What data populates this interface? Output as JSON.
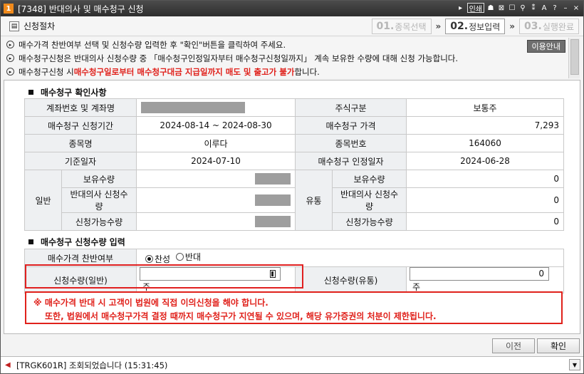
{
  "window": {
    "app_icon": "1",
    "title": "[7348] 반대의사 및 매수청구 신청",
    "tools": [
      "▸",
      "인쇄",
      "☗",
      "⊠",
      "☐",
      "⚲",
      "⁑",
      "A",
      "?",
      "–",
      "×"
    ]
  },
  "stepbar": {
    "label": "신청절차",
    "steps": [
      {
        "num": "01.",
        "label": "종목선택"
      },
      {
        "num": "02.",
        "label": "정보입력"
      },
      {
        "num": "03.",
        "label": "실행완료"
      }
    ],
    "arrow": "»"
  },
  "notice": {
    "line1": "매수가격 찬반여부 선택 및 신청수량 입력한 후 \"확인\"버튼을 클릭하여 주세요.",
    "line2": "매수청구신청은 반대의사 신청수량 중 「매수청구인정일자부터 매수청구신청일까지」 계속 보유한 수량에 대해 신청 가능합니다.",
    "line3_prefix": "매수청구신청 시 ",
    "line3_red": "매수청구일로부터 매수청구대금 지급일까지 매도 및 출고가 불가",
    "line3_suffix": "합니다.",
    "guide_button": "이용안내"
  },
  "confirm": {
    "title": "매수청구 확인사항",
    "account_label": "계좌번호 및 계좌명",
    "stock_type_label": "주식구분",
    "stock_type_value": "보통주",
    "period_label": "매수청구 신청기간",
    "period_value": "2024-08-14 ~ 2024-08-30",
    "price_label": "매수청구 가격",
    "price_value": "7,293",
    "name_label": "종목명",
    "name_value": "이루다",
    "code_label": "종목번호",
    "code_value": "164060",
    "base_date_label": "기준일자",
    "base_date_value": "2024-07-10",
    "recog_date_label": "매수청구 인정일자",
    "recog_date_value": "2024-06-28",
    "general_label": "일반",
    "circ_label": "유통",
    "hold_label": "보유수량",
    "oppose_label": "반대의사 신청수량",
    "avail_label": "신청가능수량",
    "circ_hold": "0",
    "circ_oppose": "0",
    "circ_avail": "0"
  },
  "input": {
    "title": "매수청구 신청수량 입력",
    "approval_label": "매수가격 찬반여부",
    "approve": "찬성",
    "oppose": "반대",
    "general_qty_label": "신청수량(일반)",
    "general_qty_value": "",
    "unit": "주",
    "circ_qty_label": "신청수량(유통)",
    "circ_qty_value": "0"
  },
  "warning": {
    "line1": "※ 매수가격 반대 시 고객이 법원에 직접 이의신청을 해야 합니다.",
    "line2": "또한, 법원에서 매수청구가격 결정 때까지 매수청구가 지연될 수 있으며, 해당 유가증권의 처분이 제한됩니다."
  },
  "buttons": {
    "prev": "이전",
    "ok": "확인"
  },
  "status": {
    "text": "[TRGK601R] 조회되었습니다 (15:31:45)"
  }
}
